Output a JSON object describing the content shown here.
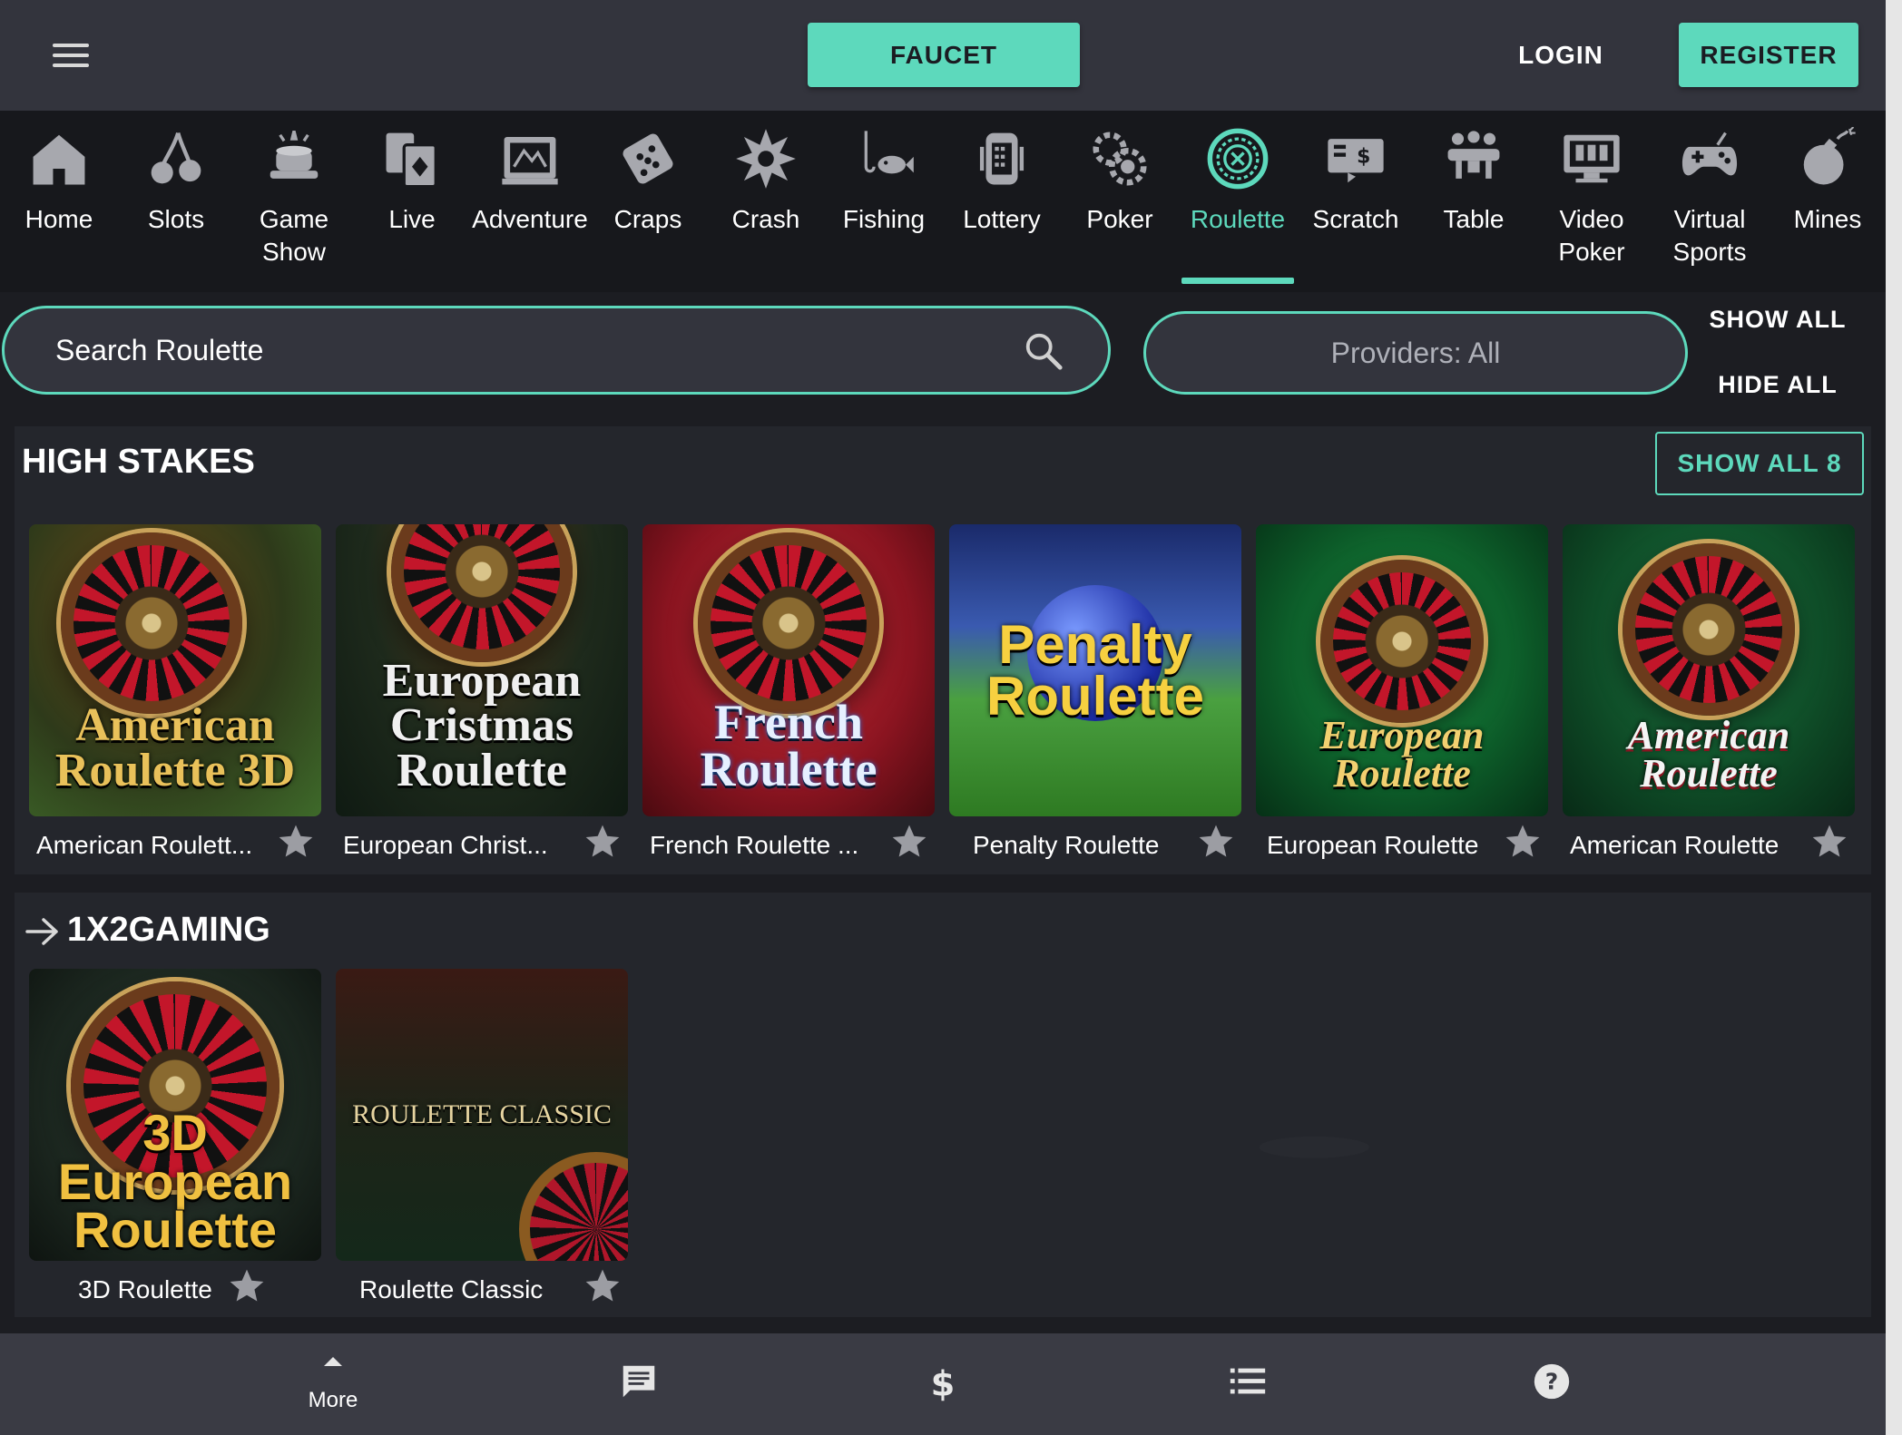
{
  "header": {
    "faucet_label": "FAUCET",
    "login_label": "LOGIN",
    "register_label": "REGISTER"
  },
  "categories": [
    {
      "label": "Home",
      "icon": "home-icon"
    },
    {
      "label": "Slots",
      "icon": "cherries-icon"
    },
    {
      "label": "Game\nShow",
      "icon": "game-show-icon"
    },
    {
      "label": "Live",
      "icon": "cards-icon"
    },
    {
      "label": "Adventure",
      "icon": "map-icon"
    },
    {
      "label": "Craps",
      "icon": "dice-icon"
    },
    {
      "label": "Crash",
      "icon": "explosion-icon"
    },
    {
      "label": "Fishing",
      "icon": "fishing-icon"
    },
    {
      "label": "Lottery",
      "icon": "lottery-icon"
    },
    {
      "label": "Poker",
      "icon": "chips-icon"
    },
    {
      "label": "Roulette",
      "icon": "roulette-icon",
      "active": true
    },
    {
      "label": "Scratch",
      "icon": "scratch-icon"
    },
    {
      "label": "Table",
      "icon": "table-icon"
    },
    {
      "label": "Video\nPoker",
      "icon": "video-poker-icon"
    },
    {
      "label": "Virtual\nSports",
      "icon": "gamepad-icon"
    },
    {
      "label": "Mines",
      "icon": "bomb-icon"
    }
  ],
  "search": {
    "placeholder": "Search Roulette"
  },
  "providers_label": "Providers: All",
  "show_all_label": "SHOW ALL",
  "hide_all_label": "HIDE ALL",
  "sections": [
    {
      "title": "HIGH STAKES",
      "show_all_label": "SHOW ALL 8",
      "games": [
        {
          "name": "American Roulett...",
          "art_title": "American Roulette 3D"
        },
        {
          "name": "European Christ...",
          "art_title": "European Cristmas Roulette"
        },
        {
          "name": "French Roulette ...",
          "art_title": "French Roulette"
        },
        {
          "name": "Penalty Roulette",
          "art_title": "Penalty Roulette"
        },
        {
          "name": "European Roulette",
          "art_title": "European Roulette"
        },
        {
          "name": "American Roulette",
          "art_title": "American Roulette"
        }
      ]
    },
    {
      "title": "1X2GAMING",
      "games": [
        {
          "name": "3D Roulette",
          "art_title": "3D European Roulette"
        },
        {
          "name": "Roulette Classic",
          "art_title": "ROULETTE CLASSIC"
        }
      ]
    }
  ],
  "bottom_bar": {
    "more_label": "More"
  },
  "colors": {
    "accent": "#5dd9bc",
    "header_bg": "#33343d",
    "nav_bg": "#17181c",
    "section_bg": "#24262c"
  }
}
